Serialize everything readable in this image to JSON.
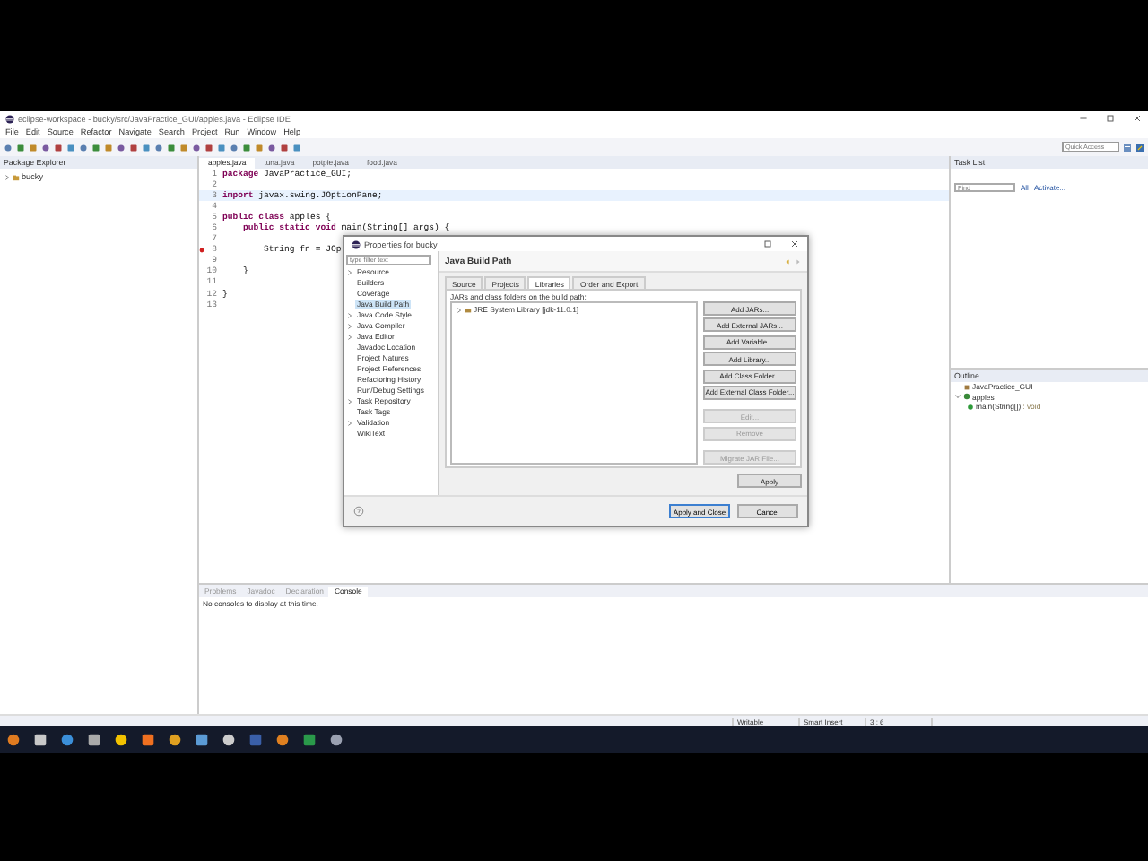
{
  "window": {
    "title": "eclipse-workspace - bucky/src/JavaPractice_GUI/apples.java - Eclipse IDE"
  },
  "menu": [
    "File",
    "Edit",
    "Source",
    "Refactor",
    "Navigate",
    "Search",
    "Project",
    "Run",
    "Window",
    "Help"
  ],
  "quick_access": {
    "placeholder": "Quick Access"
  },
  "package_explorer": {
    "title": "Package Explorer",
    "items": [
      {
        "label": "bucky",
        "expanded": false
      }
    ]
  },
  "editor": {
    "tabs": [
      {
        "label": "apples.java",
        "selected": true
      },
      {
        "label": "tuna.java",
        "selected": false
      },
      {
        "label": "potpie.java",
        "selected": false
      },
      {
        "label": "food.java",
        "selected": false
      }
    ],
    "lines": [
      {
        "number": "1",
        "code": "**package** JavaPractice_GUI;",
        "current": false,
        "error": false
      },
      {
        "number": "2",
        "current": false,
        "error": false
      },
      {
        "number": "3",
        "code": "**import** javax.swing.JOptionPane;",
        "current": true,
        "error": false
      },
      {
        "number": "4",
        "current": false,
        "error": false
      },
      {
        "number": "5",
        "code": "**public class** apples {",
        "current": false,
        "error": false
      },
      {
        "number": "6",
        "code": "    **public static void** main(String[] args) {",
        "current": false,
        "error": false
      },
      {
        "number": "7",
        "current": false,
        "error": false
      },
      {
        "number": "8",
        "code": "        String fn = JOp",
        "current": false,
        "error": true
      },
      {
        "number": "9",
        "current": false,
        "error": false
      },
      {
        "number": "10",
        "code": "    }",
        "current": false,
        "error": false
      },
      {
        "number": "11",
        "current": false,
        "error": false
      },
      {
        "number": "12",
        "code": "}",
        "current": false,
        "error": false
      },
      {
        "number": "13",
        "current": false,
        "error": false
      }
    ]
  },
  "task_list": {
    "title": "Task List",
    "find": {
      "placeholder": "Find"
    },
    "links": [
      "All",
      "Activate..."
    ]
  },
  "outline": {
    "title": "Outline",
    "items": [
      {
        "label": "JavaPractice_GUI",
        "kind": "package"
      },
      {
        "label": "apples",
        "kind": "class",
        "expanded": true,
        "children": [
          {
            "label": "main(String[])",
            "type": " : void",
            "kind": "method"
          }
        ]
      }
    ]
  },
  "bottom": {
    "tabs": [
      {
        "label": "Problems",
        "selected": false
      },
      {
        "label": "Javadoc",
        "selected": false
      },
      {
        "label": "Declaration",
        "selected": false
      },
      {
        "label": "Console",
        "selected": true
      }
    ],
    "message": "No consoles to display at this time."
  },
  "status_bar": [
    "Writable",
    "Smart Insert",
    "3 : 6"
  ],
  "dialog": {
    "title": "Properties for bucky",
    "filter": {
      "placeholder": "type filter text"
    },
    "nav": [
      {
        "label": "Resource",
        "expandable": true,
        "selected": false
      },
      {
        "label": "Builders",
        "expandable": false,
        "selected": false
      },
      {
        "label": "Coverage",
        "expandable": false,
        "selected": false
      },
      {
        "label": "Java Build Path",
        "expandable": false,
        "selected": true
      },
      {
        "label": "Java Code Style",
        "expandable": true,
        "selected": false
      },
      {
        "label": "Java Compiler",
        "expandable": true,
        "selected": false
      },
      {
        "label": "Java Editor",
        "expandable": true,
        "selected": false
      },
      {
        "label": "Javadoc Location",
        "expandable": false,
        "selected": false
      },
      {
        "label": "Project Natures",
        "expandable": false,
        "selected": false
      },
      {
        "label": "Project References",
        "expandable": false,
        "selected": false
      },
      {
        "label": "Refactoring History",
        "expandable": false,
        "selected": false
      },
      {
        "label": "Run/Debug Settings",
        "expandable": false,
        "selected": false
      },
      {
        "label": "Task Repository",
        "expandable": true,
        "selected": false
      },
      {
        "label": "Task Tags",
        "expandable": false,
        "selected": false
      },
      {
        "label": "Validation",
        "expandable": true,
        "selected": false
      },
      {
        "label": "WikiText",
        "expandable": false,
        "selected": false
      }
    ],
    "heading": "Java Build Path",
    "tabs": [
      {
        "label": "Source",
        "selected": false
      },
      {
        "label": "Projects",
        "selected": false
      },
      {
        "label": "Libraries",
        "selected": true
      },
      {
        "label": "Order and Export",
        "selected": false
      }
    ],
    "list_label": "JARs and class folders on the build path:",
    "entries": [
      {
        "label": "JRE System Library [jdk-11.0.1]",
        "expanded": false
      }
    ],
    "side_buttons": [
      {
        "label": "Add JARs...",
        "disabled": false
      },
      {
        "label": "Add External JARs...",
        "disabled": false
      },
      {
        "label": "Add Variable...",
        "disabled": false
      },
      {
        "label": "Add Library...",
        "disabled": false
      },
      {
        "label": "Add Class Folder...",
        "disabled": false
      },
      {
        "label": "Add External Class Folder...",
        "disabled": false
      },
      {
        "label": "Edit...",
        "disabled": true
      },
      {
        "label": "Remove",
        "disabled": true
      },
      {
        "label": "Migrate JAR File...",
        "disabled": true
      }
    ],
    "apply": "Apply",
    "buttons": [
      {
        "label": "Apply and Close",
        "kind": "default"
      },
      {
        "label": "Cancel",
        "kind": "normal"
      }
    ]
  }
}
